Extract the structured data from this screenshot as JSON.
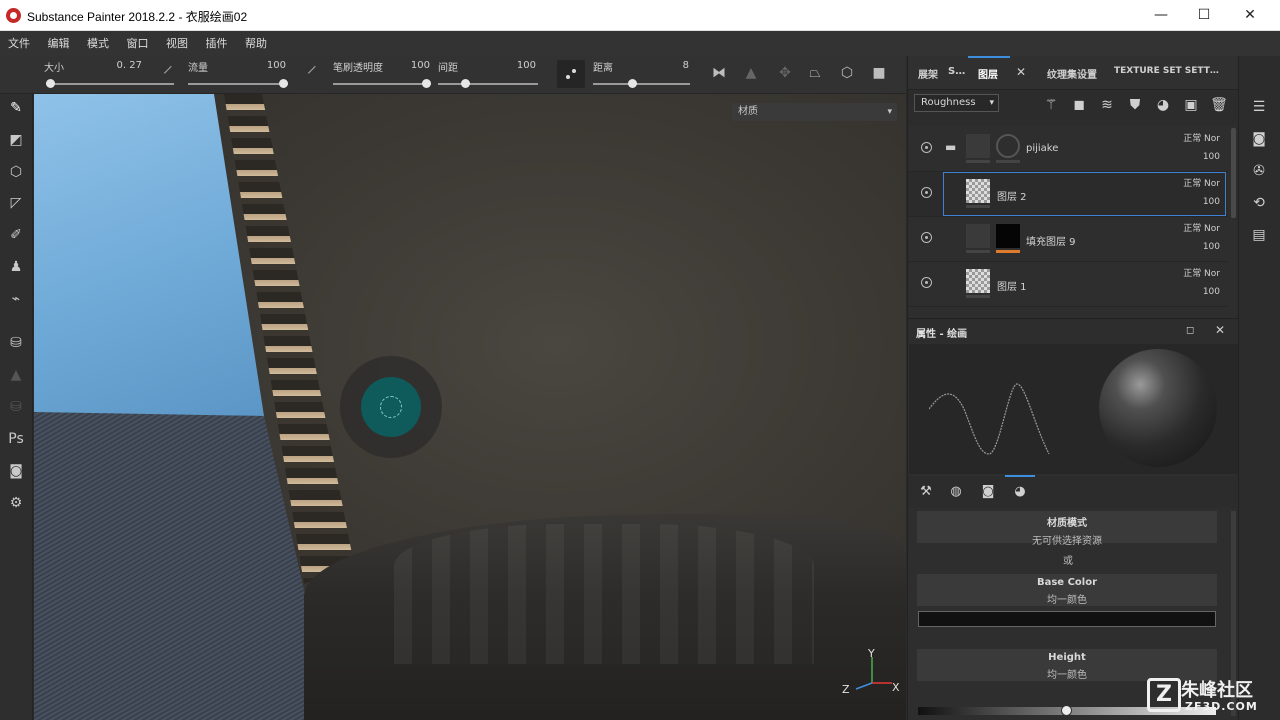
{
  "window": {
    "title": "Substance Painter 2018.2.2 - 衣服绘画02",
    "minimize": "—",
    "maximize": "☐",
    "close": "✕"
  },
  "menu": [
    "文件",
    "编辑",
    "模式",
    "窗口",
    "视图",
    "插件",
    "帮助"
  ],
  "tool_options": {
    "size_label": "大小",
    "size_value": "0. 27",
    "flow_label": "流量",
    "flow_value": "100",
    "stroke_opacity_label": "笔刷透明度",
    "stroke_opacity_value": "100",
    "spacing_label": "间距",
    "spacing_value": "100",
    "distance_label": "距离",
    "distance_value": "8"
  },
  "viewport": {
    "material_dropdown": "材质",
    "axis_y": "Y",
    "axis_z": "Z",
    "axis_x": "X"
  },
  "tabs": {
    "shelf": "展架",
    "shelf_s": "S…",
    "layers": "图层",
    "layers_close": "✕",
    "texture_set": "纹理集设置",
    "texture_set_en": "TEXTURE SET SETT…"
  },
  "layers_panel": {
    "channel_select": "Roughness",
    "layers": [
      {
        "name": "pijiake",
        "blend": "正常 Nor",
        "opacity": "100"
      },
      {
        "name": "图层 2",
        "blend": "正常 Nor",
        "opacity": "100"
      },
      {
        "name": "填充图层 9",
        "blend": "正常 Nor",
        "opacity": "100"
      },
      {
        "name": "图层 1",
        "blend": "正常 Nor",
        "opacity": "100"
      }
    ]
  },
  "properties": {
    "title": "属性 - 绘画",
    "material_mode_title": "材质模式",
    "material_mode_sub": "无可供选择资源",
    "or_text": "或",
    "base_color_title": "Base Color",
    "base_color_sub": "均一颜色",
    "height_title": "Height",
    "height_sub": "均一颜色"
  },
  "watermark": {
    "main": "朱峰社区",
    "sub": "ZF3D.COM",
    "logo": "Z"
  }
}
